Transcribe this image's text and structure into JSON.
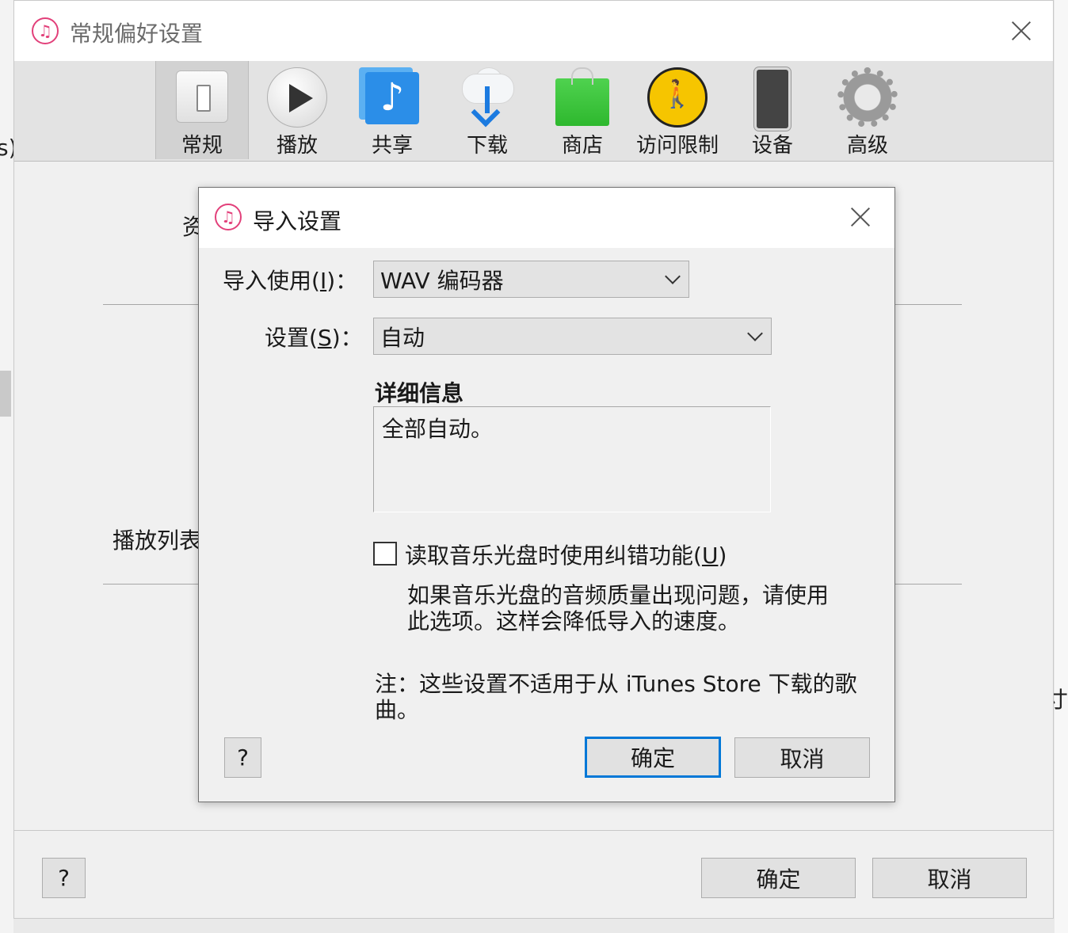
{
  "background": {
    "left_fragment": "s)",
    "right_fragment": "寸"
  },
  "main_window": {
    "title": "常规偏好设置",
    "toolbar": [
      {
        "label": "常规",
        "icon": "general-switch-icon",
        "active": true
      },
      {
        "label": "播放",
        "icon": "play-icon",
        "active": false
      },
      {
        "label": "共享",
        "icon": "music-share-icon",
        "active": false
      },
      {
        "label": "下载",
        "icon": "cloud-download-icon",
        "active": false
      },
      {
        "label": "商店",
        "icon": "store-bag-icon",
        "active": false
      },
      {
        "label": "访问限制",
        "icon": "parental-restrictions-icon",
        "active": false
      },
      {
        "label": "设备",
        "icon": "device-phone-icon",
        "active": false
      },
      {
        "label": "高级",
        "icon": "gear-icon",
        "active": false
      }
    ],
    "body_fragments": {
      "top_label_fragment": "资",
      "playlist_label_fragment": "播放列表"
    },
    "footer": {
      "help_label": "?",
      "ok_label": "确定",
      "cancel_label": "取消"
    }
  },
  "import_dialog": {
    "title": "导入设置",
    "import_using": {
      "label_prefix": "导入使用(",
      "label_accel": "I",
      "label_suffix": ")：",
      "value": "WAV 编码器"
    },
    "setting": {
      "label_prefix": "设置(",
      "label_accel": "S",
      "label_suffix": ")：",
      "value": "自动"
    },
    "details_heading": "详细信息",
    "details_text": "全部自动。",
    "error_correction": {
      "label_prefix": "读取音乐光盘时使用纠错功能(",
      "label_accel": "U",
      "label_suffix": ")",
      "checked": false
    },
    "help_text_line1": "如果音乐光盘的音频质量出现问题，请使用",
    "help_text_line2": "此选项。这样会降低导入的速度。",
    "note_line1": "注：这些设置不适用于从 iTunes Store 下载的歌",
    "note_line2": "曲。",
    "help_label": "?",
    "ok_label": "确定",
    "cancel_label": "取消"
  },
  "colors": {
    "accent": "#0078d7",
    "itunes_icon": "#e2407a"
  }
}
